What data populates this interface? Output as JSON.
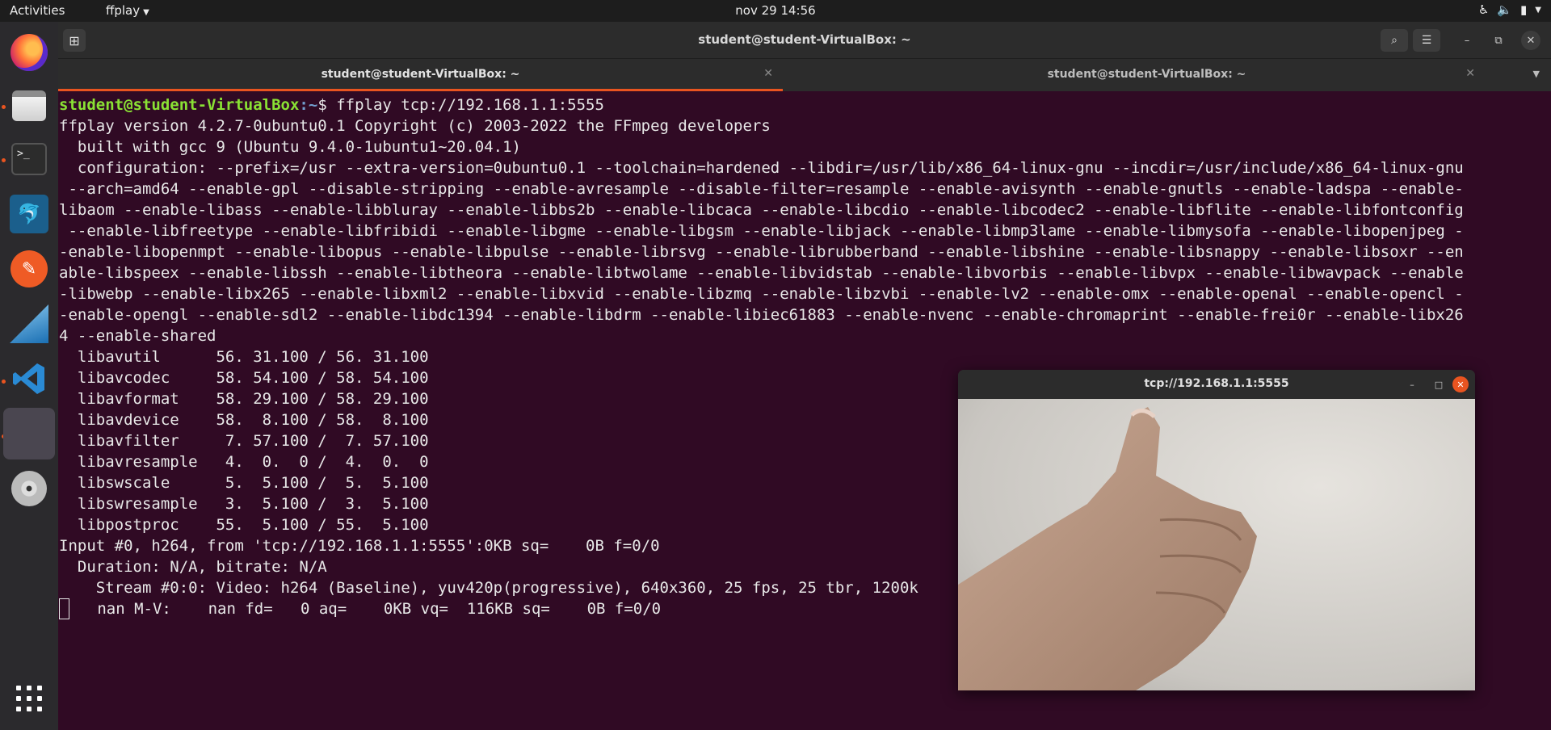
{
  "topbar": {
    "activities": "Activities",
    "app_menu": "ffplay",
    "clock": "nov 29  14:56"
  },
  "dock": {
    "items": [
      "firefox",
      "files",
      "terminal",
      "mysql-workbench",
      "postman",
      "wireshark",
      "vscode",
      "ffplay",
      "dvd",
      "show-applications"
    ]
  },
  "terminal": {
    "window_title": "student@student-VirtualBox: ~",
    "tabs": [
      {
        "label": "student@student-VirtualBox: ~",
        "active": true
      },
      {
        "label": "student@student-VirtualBox: ~",
        "active": false
      }
    ],
    "prompt_user": "student@student-VirtualBox",
    "prompt_path": ":~",
    "prompt_suffix": "$ ",
    "command": "ffplay tcp://192.168.1.1:5555",
    "output_lines": [
      "ffplay version 4.2.7-0ubuntu0.1 Copyright (c) 2003-2022 the FFmpeg developers",
      "  built with gcc 9 (Ubuntu 9.4.0-1ubuntu1~20.04.1)",
      "  configuration: --prefix=/usr --extra-version=0ubuntu0.1 --toolchain=hardened --libdir=/usr/lib/x86_64-linux-gnu --incdir=/usr/include/x86_64-linux-gnu",
      " --arch=amd64 --enable-gpl --disable-stripping --enable-avresample --disable-filter=resample --enable-avisynth --enable-gnutls --enable-ladspa --enable-",
      "libaom --enable-libass --enable-libbluray --enable-libbs2b --enable-libcaca --enable-libcdio --enable-libcodec2 --enable-libflite --enable-libfontconfig",
      " --enable-libfreetype --enable-libfribidi --enable-libgme --enable-libgsm --enable-libjack --enable-libmp3lame --enable-libmysofa --enable-libopenjpeg -",
      "-enable-libopenmpt --enable-libopus --enable-libpulse --enable-librsvg --enable-librubberband --enable-libshine --enable-libsnappy --enable-libsoxr --en",
      "able-libspeex --enable-libssh --enable-libtheora --enable-libtwolame --enable-libvidstab --enable-libvorbis --enable-libvpx --enable-libwavpack --enable",
      "-libwebp --enable-libx265 --enable-libxml2 --enable-libxvid --enable-libzmq --enable-libzvbi --enable-lv2 --enable-omx --enable-openal --enable-opencl -",
      "-enable-opengl --enable-sdl2 --enable-libdc1394 --enable-libdrm --enable-libiec61883 --enable-nvenc --enable-chromaprint --enable-frei0r --enable-libx26",
      "4 --enable-shared",
      "  libavutil      56. 31.100 / 56. 31.100",
      "  libavcodec     58. 54.100 / 58. 54.100",
      "  libavformat    58. 29.100 / 58. 29.100",
      "  libavdevice    58.  8.100 / 58.  8.100",
      "  libavfilter     7. 57.100 /  7. 57.100",
      "  libavresample   4.  0.  0 /  4.  0.  0",
      "  libswscale      5.  5.100 /  5.  5.100",
      "  libswresample   3.  5.100 /  3.  5.100",
      "  libpostproc    55.  5.100 / 55.  5.100",
      "Input #0, h264, from 'tcp://192.168.1.1:5555':0KB sq=    0B f=0/0",
      "  Duration: N/A, bitrate: N/A",
      "    Stream #0:0: Video: h264 (Baseline), yuv420p(progressive), 640x360, 25 fps, 25 tbr, 1200k"
    ],
    "status_line": "   nan M-V:    nan fd=   0 aq=    0KB vq=  116KB sq=    0B f=0/0"
  },
  "ffplay_window": {
    "title": "tcp://192.168.1.1:5555"
  },
  "colors": {
    "terminal_bg": "#300a24",
    "accent": "#e95420",
    "prompt_user": "#8ae234",
    "prompt_path": "#729fcf"
  }
}
